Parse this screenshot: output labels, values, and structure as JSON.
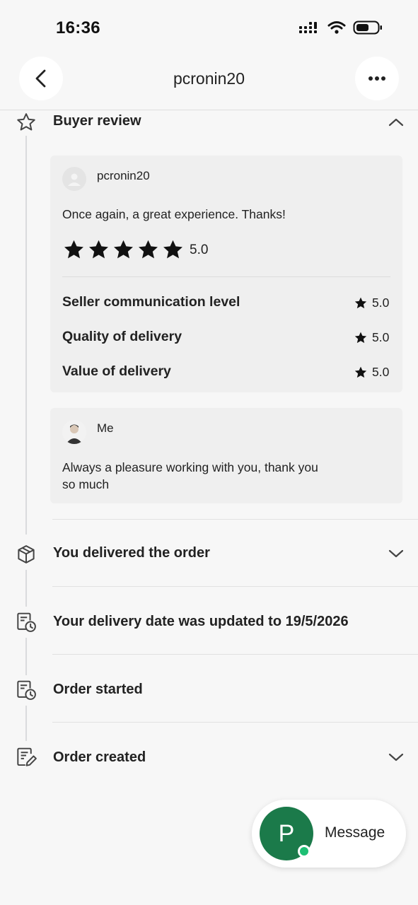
{
  "status_bar": {
    "time": "16:36"
  },
  "header": {
    "title": "pcronin20"
  },
  "buyer_review": {
    "section_title": "Buyer review",
    "review": {
      "reviewer_name": "pcronin20",
      "text": "Once again, a great experience.  Thanks!",
      "stars": 5,
      "overall_rating": "5.0",
      "sub_ratings": [
        {
          "label": "Seller communication level",
          "value": "5.0"
        },
        {
          "label": "Quality of delivery",
          "value": "5.0"
        },
        {
          "label": "Value of delivery",
          "value": "5.0"
        }
      ]
    },
    "reply": {
      "name": "Me",
      "text_line1": "Always a pleasure working with you, thank you",
      "text_line2": "so much"
    }
  },
  "timeline": [
    {
      "title": "You delivered the order",
      "icon": "package-icon",
      "expandable": true
    },
    {
      "title": "Your delivery date was updated to 19/5/2026",
      "icon": "calendar-clock-icon",
      "expandable": false
    },
    {
      "title": "Order started",
      "icon": "calendar-clock-icon",
      "expandable": false
    },
    {
      "title": "Order created",
      "icon": "document-edit-icon",
      "expandable": true
    }
  ],
  "message_button": {
    "avatar_letter": "P",
    "label": "Message",
    "status_color": "#1dbf73",
    "avatar_color": "#1b7a4a"
  }
}
